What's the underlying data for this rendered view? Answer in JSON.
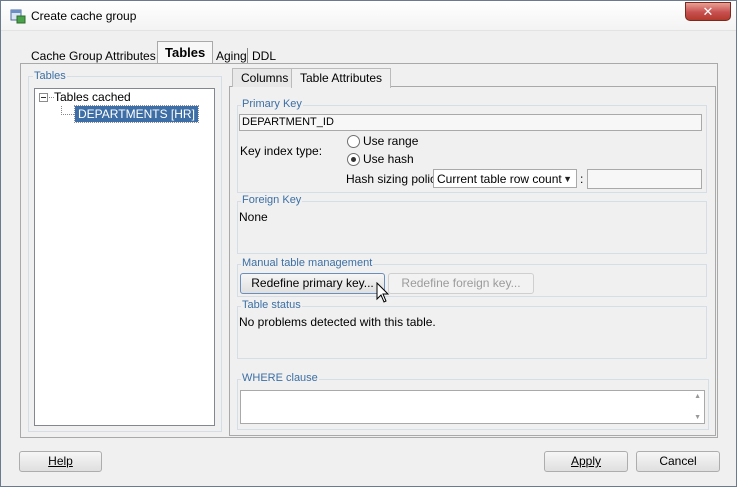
{
  "window": {
    "title": "Create cache group",
    "close_label": "✕"
  },
  "tabs": [
    {
      "label": "Cache Group Attributes"
    },
    {
      "label": "Tables"
    },
    {
      "label": "Aging"
    },
    {
      "label": "DDL"
    }
  ],
  "tables_group": {
    "title": "Tables",
    "tree": {
      "root_label": "Tables cached",
      "children": [
        "DEPARTMENTS [HR]"
      ]
    }
  },
  "inner_tabs": [
    {
      "label": "Columns"
    },
    {
      "label": "Table Attributes"
    }
  ],
  "primary_key": {
    "title": "Primary Key",
    "value": "DEPARTMENT_ID",
    "key_index_label": "Key index type:",
    "options": [
      {
        "label": "Use range",
        "checked": false
      },
      {
        "label": "Use hash",
        "checked": true
      }
    ],
    "hash_sizing_label": "Hash sizing policy",
    "hash_sizing_value": "Current table row count",
    "colon": ":",
    "hash_sizing_input": ""
  },
  "foreign_key": {
    "title": "Foreign Key",
    "value": "None"
  },
  "manual_mgmt": {
    "title": "Manual table management",
    "redefine_primary": "Redefine primary key...",
    "redefine_foreign": "Redefine foreign key..."
  },
  "table_status": {
    "title": "Table status",
    "value": "No problems detected with this table."
  },
  "where_clause": {
    "title": "WHERE clause",
    "value": ""
  },
  "footer": {
    "help": "Help",
    "apply": "Apply",
    "cancel": "Cancel"
  },
  "icons": {
    "window": "cache-group-icon",
    "close": "close-icon",
    "tree_expander": "tree-collapse-icon",
    "combo": "chevron-down-icon",
    "cursor": "mouse-pointer-icon"
  }
}
